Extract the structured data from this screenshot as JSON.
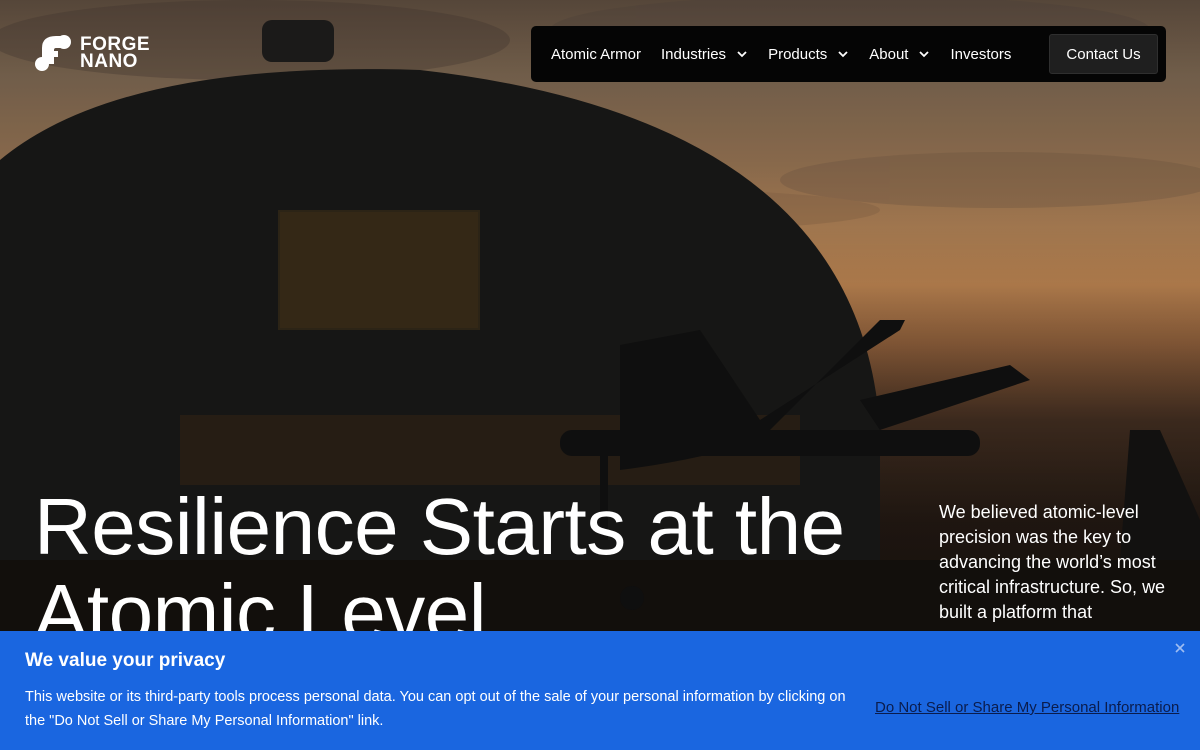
{
  "brand": {
    "name_line1": "FORGE",
    "name_line2": "NANO",
    "logo_icon": "forge-nano-mark"
  },
  "nav": {
    "items": [
      {
        "label": "Atomic Armor",
        "has_dropdown": false
      },
      {
        "label": "Industries",
        "has_dropdown": true
      },
      {
        "label": "Products",
        "has_dropdown": true
      },
      {
        "label": "About",
        "has_dropdown": true
      },
      {
        "label": "Investors",
        "has_dropdown": false
      }
    ],
    "contact_label": "Contact Us"
  },
  "hero": {
    "headline": "Resilience Starts at the Atomic Level",
    "side_copy": "We believed atomic-level precision was the key to advancing the world’s most critical infrastructure. So, we built a platform that"
  },
  "cookie_banner": {
    "title": "We value your privacy",
    "text": "This website or its third-party tools process personal data. You can opt out of the sale of your personal information by clicking on the \"Do Not Sell or Share My Personal Information\" link.",
    "link_label": "Do Not Sell or Share My Personal Information",
    "close_icon": "close-icon"
  },
  "colors": {
    "banner_bg": "#1a66e0",
    "nav_bg": "#050505",
    "link_color": "#0a1c4d"
  }
}
